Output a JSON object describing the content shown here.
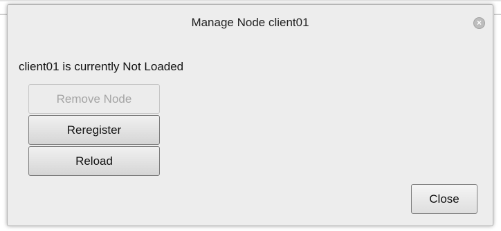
{
  "dialog": {
    "title": "Manage Node client01",
    "close_icon": "close-circle-icon",
    "status_text": "client01 is currently Not Loaded",
    "buttons": {
      "remove_node": "Remove Node",
      "reregister": "Reregister",
      "reload": "Reload",
      "close": "Close"
    }
  }
}
